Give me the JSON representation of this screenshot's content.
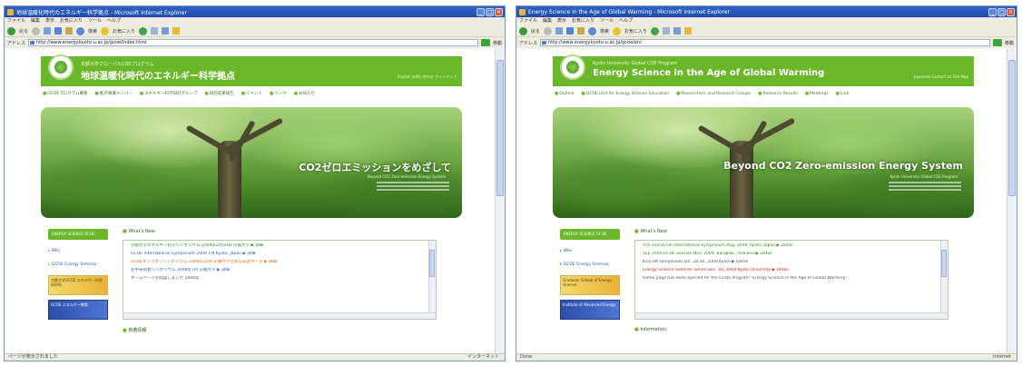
{
  "left": {
    "window_title": "地球温暖化時代のエネルギー科学拠点 - Microsoft Internet Explorer",
    "menu": [
      "ファイル",
      "編集",
      "表示",
      "お気に入り",
      "ツール",
      "ヘルプ"
    ],
    "toolbar": {
      "back": "戻る",
      "search": "検索",
      "favorites": "お気に入り"
    },
    "address_label": "アドレス",
    "address": "http://www.energy.kyoto-u.ac.jp/gcoe/index.html",
    "go_label": "移動",
    "site_sub": "京都大学グローバルCOEプログラム",
    "site_title": "地球温暖化時代のエネルギー科学拠点",
    "header_links": "English  お問い合わせ  サイトマップ",
    "nav": [
      "GCOEプログラム概要",
      "拠点事業メンバー",
      "エネルギー科学研究グループ",
      "研究成果報告",
      "イベント",
      "リンク",
      "お知らせ"
    ],
    "hero_caption": "CO2ゼロエミッションをめざして",
    "hero_sub": "Beyond CO2 Zero-emission Energy System",
    "sidebar": {
      "banner": "ENERGY SCIENCE GCOE",
      "links": [
        "Wiki",
        "GCOE Energy Seminar"
      ],
      "img1": "京都大学GCOE エネルギー科学研究所",
      "img2": "GCOE エネルギー教育"
    },
    "news_title": "What's New",
    "news": [
      {
        "text": "京都大学エネルギー科学シンポジウム 2009年2月20日 京都大学 ▶ 詳細",
        "color": "green"
      },
      {
        "text": "GCOE International Symposium 2009 1月 Kyoto, Japan ▶ 詳細",
        "color": "blue"
      },
      {
        "text": "GCOEキックオフシンポジウム 2008年10月 京都大学百周年記念ホール ▶ 詳細",
        "color": "orange"
      },
      {
        "text": "若手研究者シンポジウム 2008年7月 京都大学 ▶ 詳細",
        "color": "blue"
      },
      {
        "text": "ホームページを開設しました 2008年",
        "color": "dark"
      }
    ],
    "news_title2": "新着情報",
    "status": "ページが表示されました",
    "zone": "インターネット"
  },
  "right": {
    "window_title": "Energy Science in the Age of Global Warming - Microsoft Internet Explorer",
    "menu": [
      "ファイル",
      "編集",
      "表示",
      "お気に入り",
      "ツール",
      "ヘルプ"
    ],
    "toolbar": {
      "back": "戻る",
      "search": "検索",
      "favorites": "お気に入り"
    },
    "address_label": "アドレス",
    "address": "http://www.energy.kyoto-u.ac.jp/gcoe/en/",
    "go_label": "移動",
    "site_sub": "Kyoto University Global COE Program",
    "site_title": "Energy Science in the Age of Global Warming",
    "header_links": "Japanese  Contact Us  Site Map",
    "nav": [
      "Outline",
      "GCOE Unit for Energy Science Education",
      "Researchers and Research Groups",
      "Research Results",
      "Meetings",
      "Link"
    ],
    "hero_caption": "Beyond CO2 Zero-emission Energy System",
    "hero_sub": "Kyoto University Global COE Program",
    "sidebar": {
      "banner": "ENERGY SCIENCE GCOE",
      "links": [
        "Wiki",
        "GCOE Energy Seminar"
      ],
      "img1": "Graduate School of Energy Science",
      "img2": "Institute of Advanced Energy"
    },
    "news_title": "What's New",
    "news": [
      {
        "text": "The 2nd GCOE International Symposium  Aug. 2009, Kyoto, Japan ▶ Detail",
        "color": "green"
      },
      {
        "text": "SEE 2009 GCOE Session  Nov. 2009, Bangkok, Thailand ▶ Detail",
        "color": "green"
      },
      {
        "text": "Kick-off symposium Jan. 28-30, 2009 Kyoto ▶ Detail",
        "color": "dark"
      },
      {
        "text": "Energy Science Seminar Series  Dec. 10, 2008 Kyoto University ▶ Detail",
        "color": "red"
      },
      {
        "text": "Home page has been opened for the GCOE Program \"Energy Science in the Age of Global Warming\"",
        "color": "dark"
      }
    ],
    "news_title2": "Information",
    "status": "Done",
    "zone": "Internet"
  }
}
